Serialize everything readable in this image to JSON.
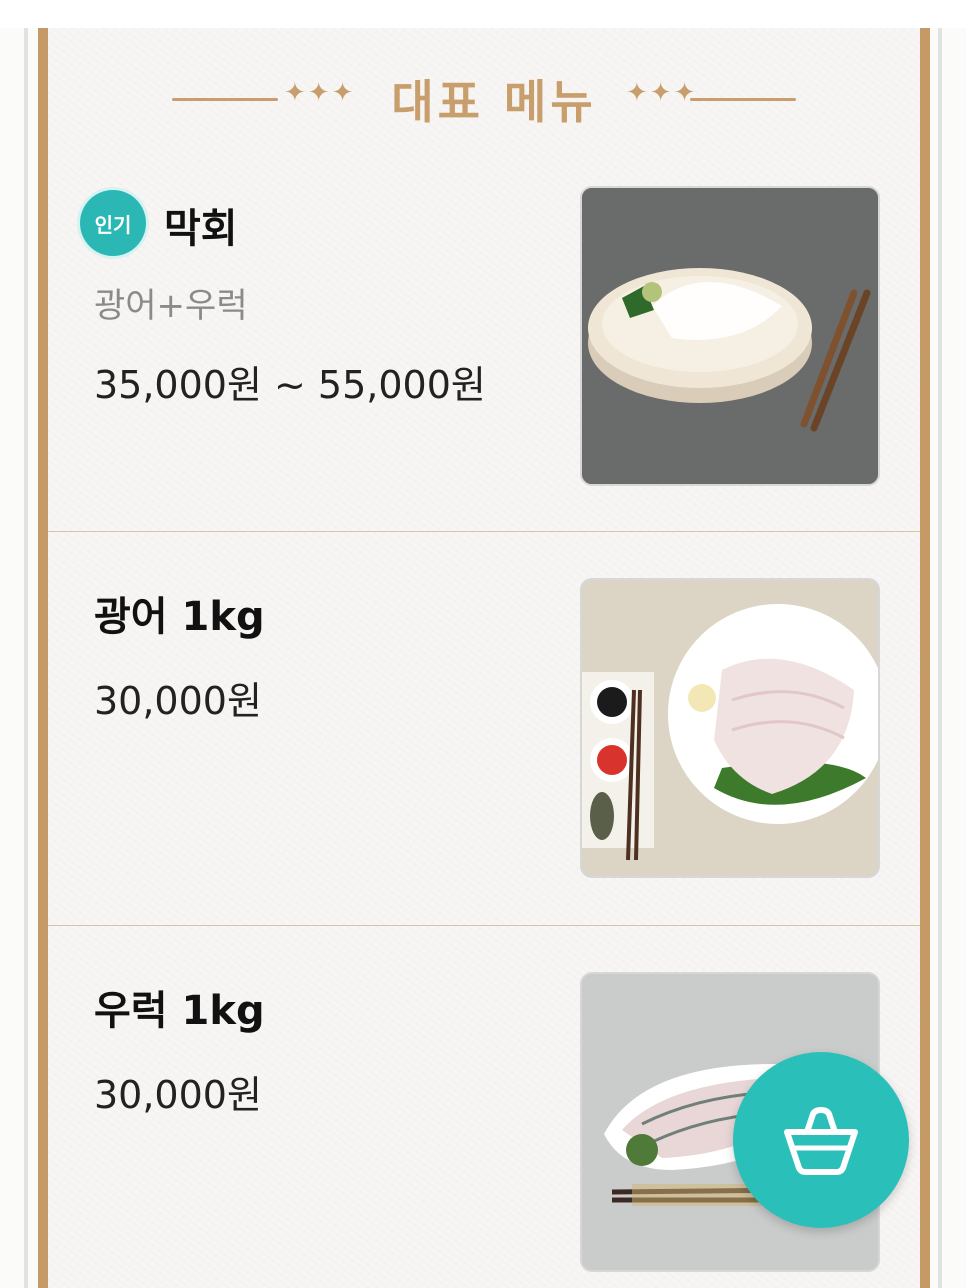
{
  "section": {
    "title": "대표 메뉴",
    "ornament_left": "✦✦✦",
    "ornament_right": "✦✦✦"
  },
  "menu": [
    {
      "badge": "인기",
      "name": "막회",
      "sub": "광어+우럭",
      "price": "35,000원 ~ 55,000원",
      "image": "plate-icon"
    },
    {
      "name": "광어 1kg",
      "price": "30,000원",
      "image": "plate-icon"
    },
    {
      "name": "우럭 1kg",
      "price": "30,000원",
      "image": "plate-icon"
    }
  ],
  "cart_button": {
    "icon": "shopping-basket-icon",
    "color": "#2bbfba"
  },
  "colors": {
    "accent_gold": "#c79e6c",
    "badge_teal": "#2bb8b4"
  }
}
